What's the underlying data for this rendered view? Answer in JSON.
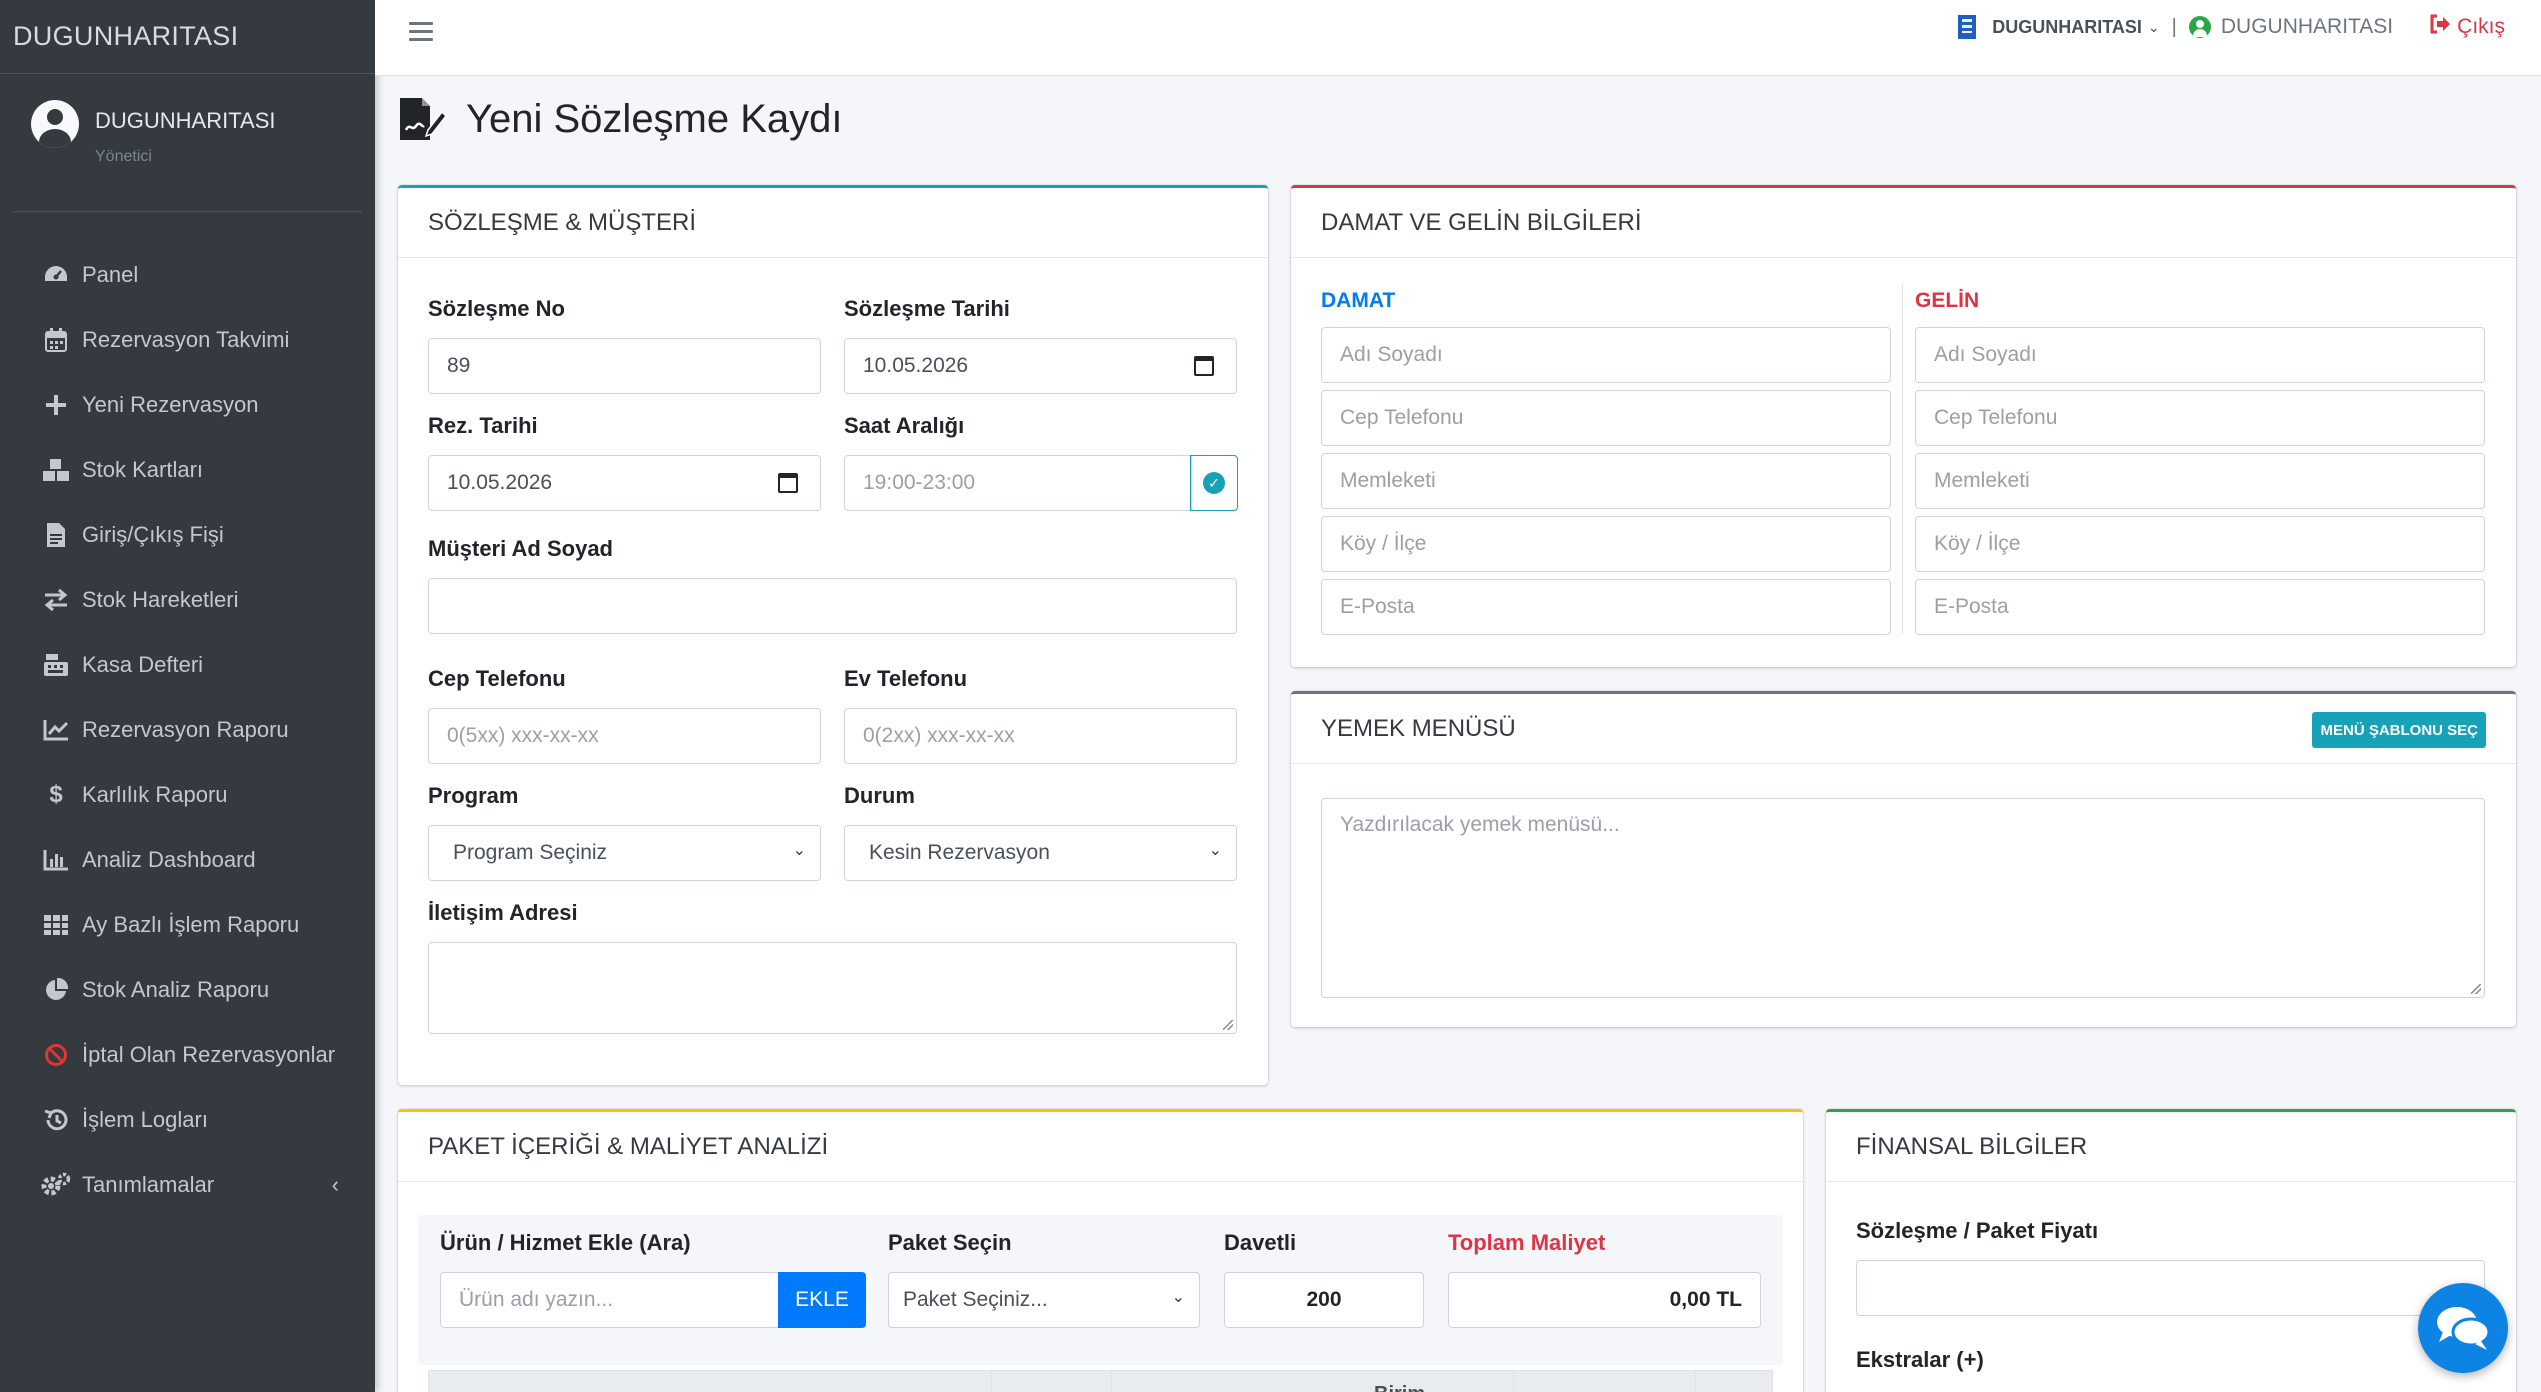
{
  "brand": "DUGUNHARITASI",
  "user": {
    "name": "DUGUNHARITASI",
    "role": "Yönetici"
  },
  "nav": [
    {
      "label": "Panel",
      "icon": "tachometer-icon"
    },
    {
      "label": "Rezervasyon Takvimi",
      "icon": "calendar-icon"
    },
    {
      "label": "Yeni Rezervasyon",
      "icon": "plus-icon"
    },
    {
      "label": "Stok Kartları",
      "icon": "boxes-icon"
    },
    {
      "label": "Giriş/Çıkış Fişi",
      "icon": "file-invoice-icon"
    },
    {
      "label": "Stok Hareketleri",
      "icon": "exchange-icon"
    },
    {
      "label": "Kasa Defteri",
      "icon": "cash-register-icon"
    },
    {
      "label": "Rezervasyon Raporu",
      "icon": "line-chart-icon"
    },
    {
      "label": "Karlılık Raporu",
      "icon": "dollar-icon"
    },
    {
      "label": "Analiz Dashboard",
      "icon": "bar-chart-icon"
    },
    {
      "label": "Ay Bazlı İşlem Raporu",
      "icon": "grid-icon"
    },
    {
      "label": "Stok Analiz Raporu",
      "icon": "pie-chart-icon"
    },
    {
      "label": "İptal Olan Rezervasyonlar",
      "icon": "ban-icon"
    },
    {
      "label": "İşlem Logları",
      "icon": "history-icon"
    },
    {
      "label": "Tanımlamalar",
      "icon": "cogs-icon"
    }
  ],
  "topbar": {
    "company": "DUGUNHARITASI",
    "user": "DUGUNHARITASI",
    "logout": "Çıkış"
  },
  "page": {
    "title": "Yeni Sözleşme Kaydı"
  },
  "contract": {
    "header": "SÖZLEŞME & MÜŞTERİ",
    "no_label": "Sözleşme No",
    "no_value": "89",
    "date_label": "Sözleşme Tarihi",
    "date_value": "10.05.2026",
    "rez_label": "Rez. Tarihi",
    "rez_value": "10.05.2026",
    "time_label": "Saat Aralığı",
    "time_placeholder": "19:00-23:00",
    "customer_label": "Müşteri Ad Soyad",
    "cell_label": "Cep Telefonu",
    "cell_placeholder": "0(5xx) xxx-xx-xx",
    "home_label": "Ev Telefonu",
    "home_placeholder": "0(2xx) xxx-xx-xx",
    "program_label": "Program",
    "program_value": "Program Seçiniz",
    "status_label": "Durum",
    "status_value": "Kesin Rezervasyon",
    "address_label": "İletişim Adresi"
  },
  "couple": {
    "header": "DAMAT VE GELİN BİLGİLERİ",
    "groom": "DAMAT",
    "bride": "GELİN",
    "fields": [
      "Adı Soyadı",
      "Cep Telefonu",
      "Memleketi",
      "Köy / İlçe",
      "E-Posta"
    ],
    "groom_color": "#007bff",
    "bride_color": "#dc3545"
  },
  "menu": {
    "header": "YEMEK MENÜSÜ",
    "template_button": "MENÜ ŞABLONU SEÇ",
    "placeholder": "Yazdırılacak yemek menüsü..."
  },
  "package": {
    "header": "PAKET İÇERİĞİ & MALİYET ANALİZİ",
    "product_label": "Ürün / Hizmet Ekle (Ara)",
    "product_placeholder": "Ürün adı yazın...",
    "add_button": "EKLE",
    "package_label": "Paket Seçin",
    "package_value": "Paket Seçiniz...",
    "guests_label": "Davetli",
    "guests_value": "200",
    "cost_label": "Toplam Maliyet",
    "cost_value": "0,00 TL",
    "table_col": "Birim"
  },
  "finance": {
    "header": "FİNANSAL BİLGİLER",
    "price_label": "Sözleşme / Paket Fiyatı",
    "extras_label": "Ekstralar (+)"
  },
  "colors": {
    "sidebar": "#343a40",
    "info": "#17a2b8",
    "danger": "#dc3545",
    "secondary": "#6c757d",
    "warning": "#ffc107",
    "success": "#28a745",
    "primary": "#007bff"
  }
}
